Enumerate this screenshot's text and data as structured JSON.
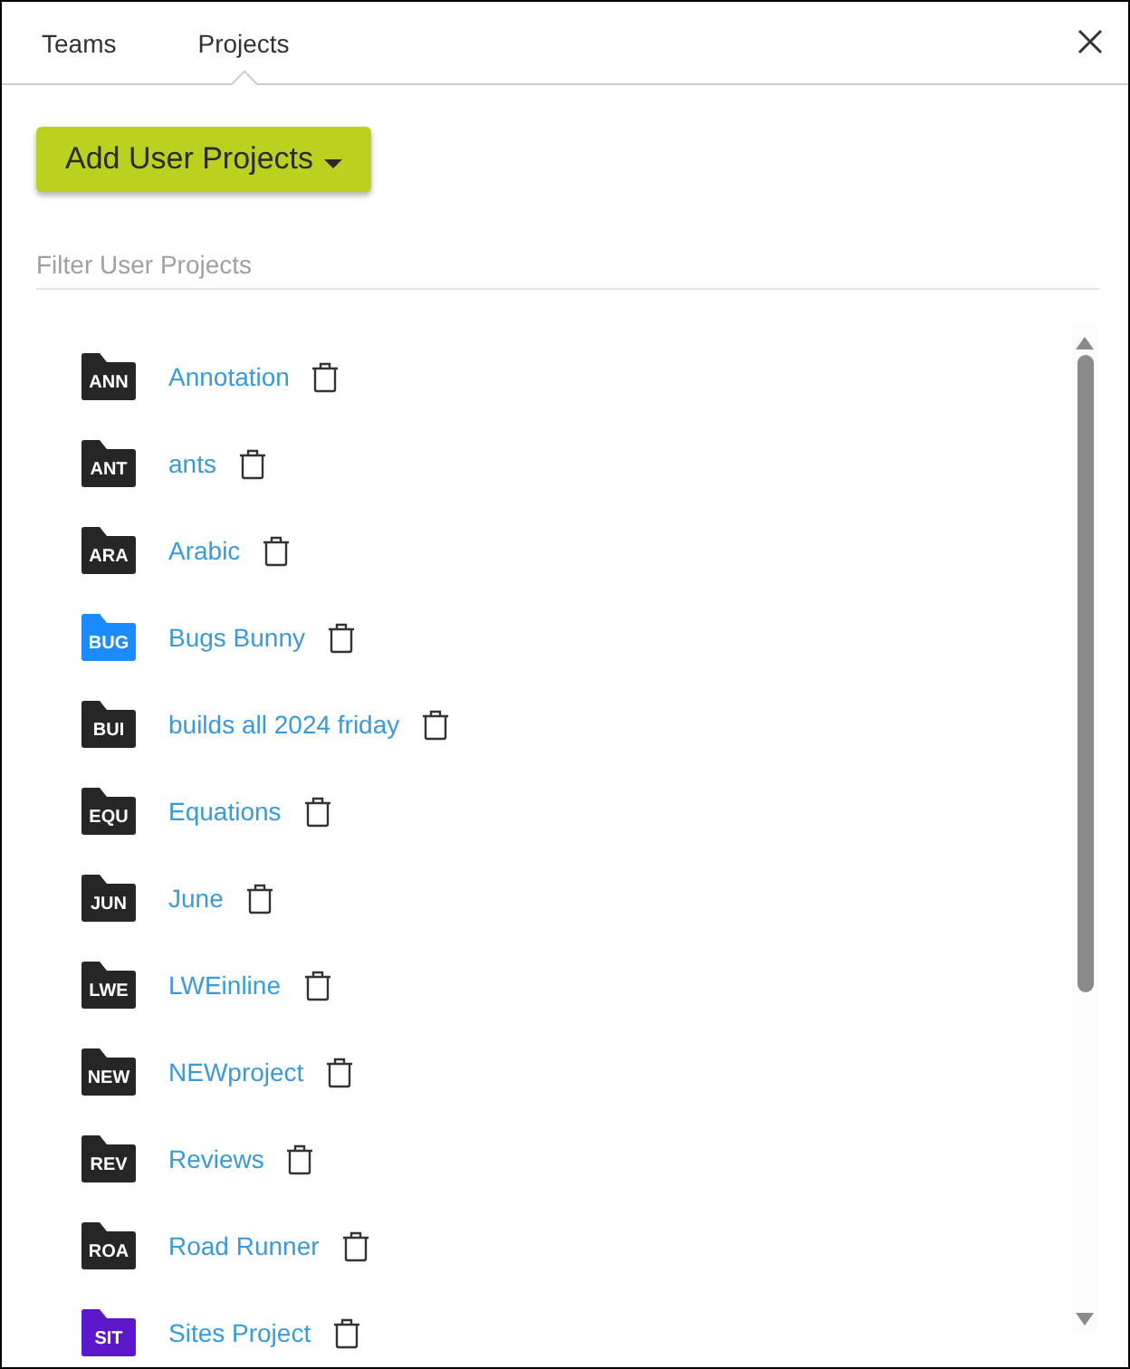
{
  "tabs": [
    {
      "label": "Teams",
      "selected": false
    },
    {
      "label": "Projects",
      "selected": true
    }
  ],
  "add_button": {
    "label": "Add User Projects"
  },
  "filter": {
    "placeholder": "Filter User Projects"
  },
  "projects": [
    {
      "code": "ANN",
      "name": "Annotation",
      "color": "#262626"
    },
    {
      "code": "ANT",
      "name": "ants",
      "color": "#262626"
    },
    {
      "code": "ARA",
      "name": "Arabic",
      "color": "#262626"
    },
    {
      "code": "BUG",
      "name": "Bugs Bunny",
      "color": "#1a8cff"
    },
    {
      "code": "BUI",
      "name": "builds all 2024 friday",
      "color": "#262626"
    },
    {
      "code": "EQU",
      "name": "Equations",
      "color": "#262626"
    },
    {
      "code": "JUN",
      "name": "June",
      "color": "#262626"
    },
    {
      "code": "LWE",
      "name": "LWEinline",
      "color": "#262626"
    },
    {
      "code": "NEW",
      "name": "NEWproject",
      "color": "#262626"
    },
    {
      "code": "REV",
      "name": "Reviews",
      "color": "#262626"
    },
    {
      "code": "ROA",
      "name": "Road Runner",
      "color": "#262626"
    },
    {
      "code": "SIT",
      "name": "Sites Project",
      "color": "#5b17c9"
    }
  ]
}
